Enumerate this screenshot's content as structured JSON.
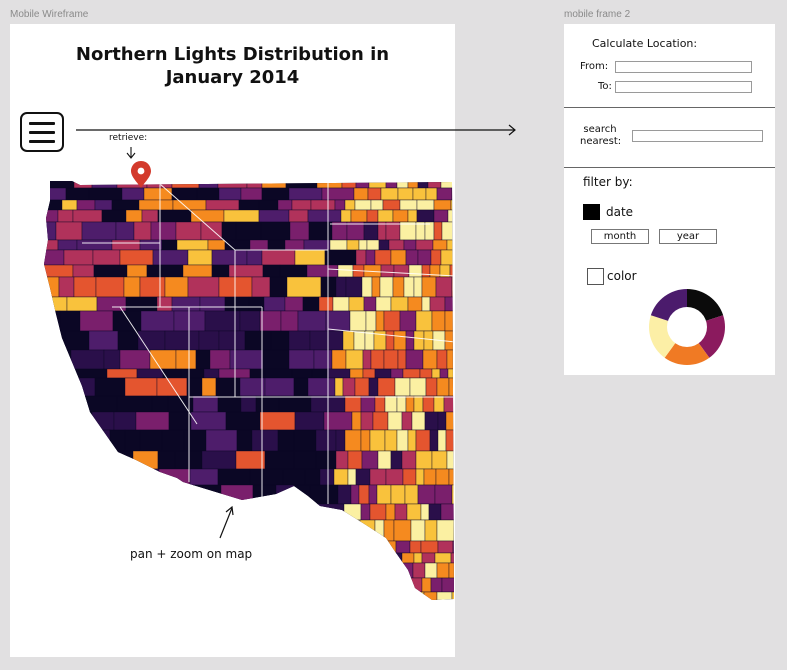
{
  "canvas": {
    "frame1_label": "Mobile Wireframe",
    "frame2_label": "mobile frame 2"
  },
  "frame1": {
    "title_line1": "Northern Lights Distribution in",
    "title_line2": "January 2014",
    "menu_icon": "hamburger-menu-icon",
    "retrieve_label": "retrieve:",
    "pin_icon": "location-pin-icon",
    "pin_color": "#d33a2c",
    "map_caption": "pan + zoom on map",
    "map_palette": [
      "#0b0725",
      "#2a0f4a",
      "#4e1d6b",
      "#7a1f6c",
      "#b1325b",
      "#e4552f",
      "#f58a1f",
      "#f9c23c",
      "#fbf0a2"
    ]
  },
  "frame2": {
    "calc_title": "Calculate Location:",
    "from_label": "From:",
    "to_label": "To:",
    "from_value": "",
    "to_value": "",
    "search_label_line1": "search",
    "search_label_line2": "nearest:",
    "search_value": "",
    "filter_title": "filter by:",
    "date_label": "date",
    "date_checked": true,
    "month_label": "month",
    "year_label": "year",
    "color_label": "color",
    "color_checked": false,
    "donut_colors": [
      "#0b0b0b",
      "#8b1a5e",
      "#f07a24",
      "#fcefa6",
      "#4b1b6c"
    ]
  }
}
